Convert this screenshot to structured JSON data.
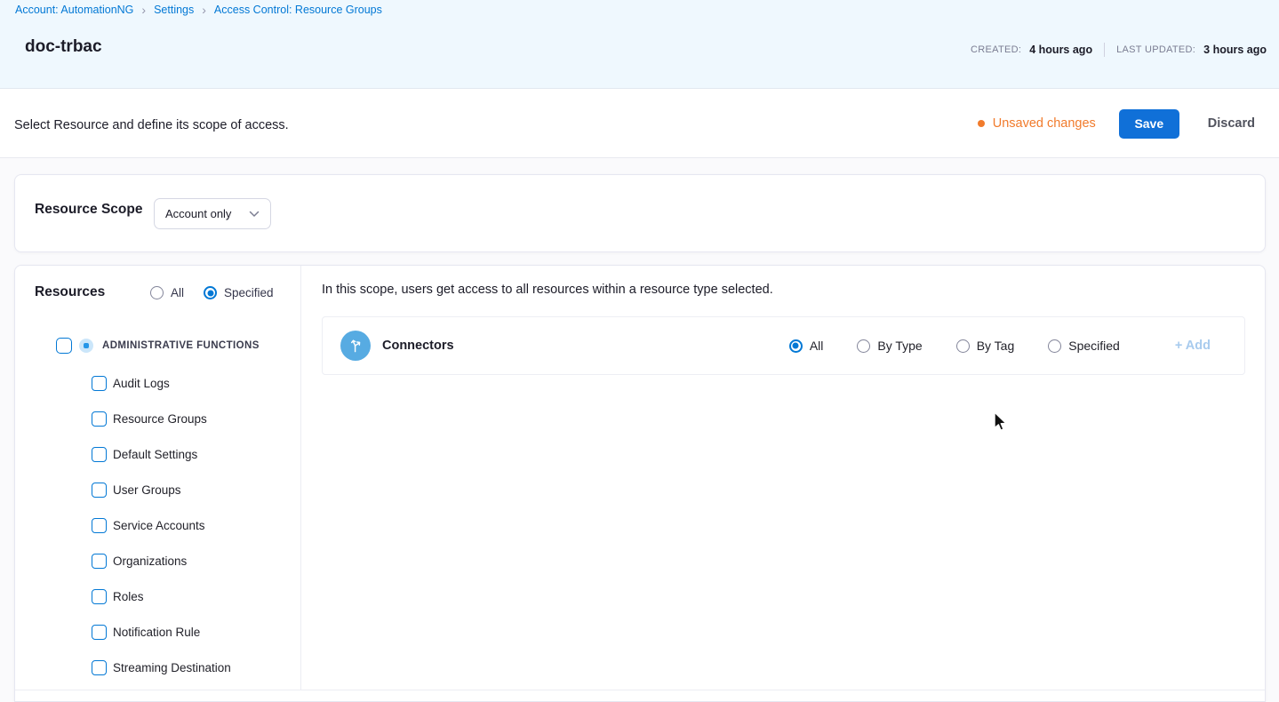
{
  "breadcrumb": {
    "separator": "›",
    "items": [
      "Account: AutomationNG",
      "Settings",
      "Access Control: Resource Groups"
    ]
  },
  "header": {
    "title": "doc-trbac",
    "created_label": "CREATED:",
    "created_value": "4 hours ago",
    "updated_label": "LAST UPDATED:",
    "updated_value": "3 hours ago"
  },
  "toolbar": {
    "description": "Select Resource and define its scope of access.",
    "unsaved_label": "Unsaved changes",
    "save_label": "Save",
    "discard_label": "Discard"
  },
  "resource_scope": {
    "label": "Resource Scope",
    "selected_option": "Account only"
  },
  "resources": {
    "label": "Resources",
    "scope_options": [
      {
        "label": "All",
        "selected": false
      },
      {
        "label": "Specified",
        "selected": true
      }
    ],
    "group": {
      "label": "ADMINISTRATIVE FUNCTIONS",
      "checked": false
    },
    "items": [
      "Audit Logs",
      "Resource Groups",
      "Default Settings",
      "User Groups",
      "Service Accounts",
      "Organizations",
      "Roles",
      "Notification Rule",
      "Streaming Destination"
    ]
  },
  "main": {
    "info_text": "In this scope, users get access to all resources within a resource type selected.",
    "resource_row": {
      "name": "Connectors",
      "options": [
        "All",
        "By Type",
        "By Tag",
        "Specified"
      ],
      "selected_option": "All",
      "add_label": "+ Add"
    }
  },
  "colors": {
    "link_blue": "#0278D5",
    "primary_button_blue": "#1070D8",
    "unsaved_orange": "#F17B2C",
    "connector_icon_blue": "#57ABE2",
    "add_link_disabled_blue": "#A8CBEE",
    "header_background": "#EFF8FE"
  }
}
